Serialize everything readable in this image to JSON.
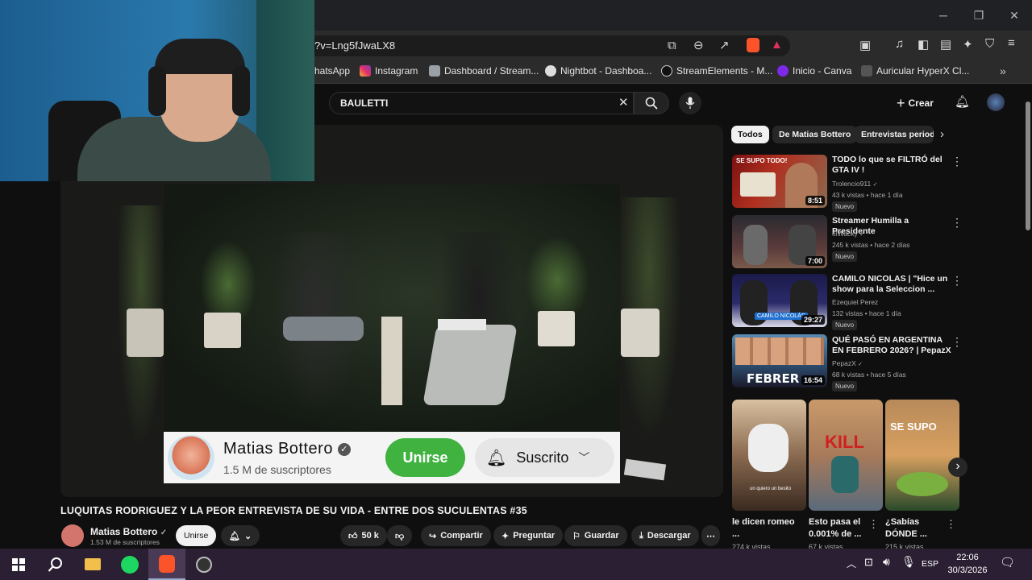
{
  "browser": {
    "url": "?v=Lng5fJwaLX8",
    "bookmarks": [
      "hatsApp",
      "Instagram",
      "Dashboard / Stream...",
      "Nightbot - Dashboa...",
      "StreamElements - M...",
      "Inicio - Canva",
      "Auricular HyperX Cl..."
    ],
    "window_controls": [
      "─",
      "❐",
      "✕"
    ]
  },
  "youtube": {
    "search_value": "BAULETTI",
    "create_label": "Crear"
  },
  "overlay": {
    "channel": "Matias Bottero",
    "subscribers": "1.5 M de suscriptores",
    "join": "Unirse",
    "subscribed": "Suscrito"
  },
  "video": {
    "title": "LUQUITAS RODRIGUEZ Y LA PEOR ENTREVISTA DE SU VIDA - ENTRE DOS SUCULENTAS #35",
    "channel": "Matias Bottero",
    "subscribers": "1.53 M de suscriptores",
    "join": "Unirse",
    "likes": "50 k",
    "share": "Compartir",
    "ask": "Preguntar",
    "save": "Guardar",
    "download": "Descargar"
  },
  "sidebar": {
    "chips": [
      "Todos",
      "De Matias Bottero",
      "Entrevistas period"
    ],
    "videos": [
      {
        "title": "TODO lo que se FILTRÓ del GTA IV !",
        "channel": "Trolencio911",
        "meta": "43 k vistas • hace 1 día",
        "badge": "Nuevo",
        "duration": "8:51",
        "thumb_text": "SE SUPO TODO!"
      },
      {
        "title": "Streamer Humilla a Presidente",
        "channel": "elWacky",
        "meta": "245 k vistas • hace 2 días",
        "badge": "Nuevo",
        "duration": "7:00",
        "thumb_text": ""
      },
      {
        "title": "CAMILO NICOLAS | \"Hice un show para la Seleccion ...",
        "channel": "Ezequiel Perez",
        "meta": "132 vistas • hace 1 día",
        "badge": "Nuevo",
        "duration": "29:27",
        "thumb_text": "CAMILO NICOLÁS"
      },
      {
        "title": "QUÉ PASÓ EN ARGENTINA EN FEBRERO 2026? | PepazX",
        "channel": "PepazX",
        "meta": "68 k vistas • hace 5 días",
        "badge": "Nuevo",
        "duration": "16:54",
        "thumb_text": "FEBRER"
      }
    ],
    "shorts": [
      {
        "title": "le dicen romeo ...",
        "views": "274 k vistas",
        "thumb_text": "un quiero un besito"
      },
      {
        "title": "Esto pasa el 0.001% de ...",
        "views": "67 k vistas",
        "thumb_text": "KILL"
      },
      {
        "title": "¿Sabías DÓNDE ...",
        "views": "215 k vistas",
        "thumb_text": "SE SUPO"
      }
    ]
  },
  "taskbar": {
    "lang": "ESP",
    "time": "22:06",
    "date": "30/3/2026"
  },
  "colors": {
    "join_green": "#3fb23f",
    "brave_orange": "#fb542b"
  }
}
